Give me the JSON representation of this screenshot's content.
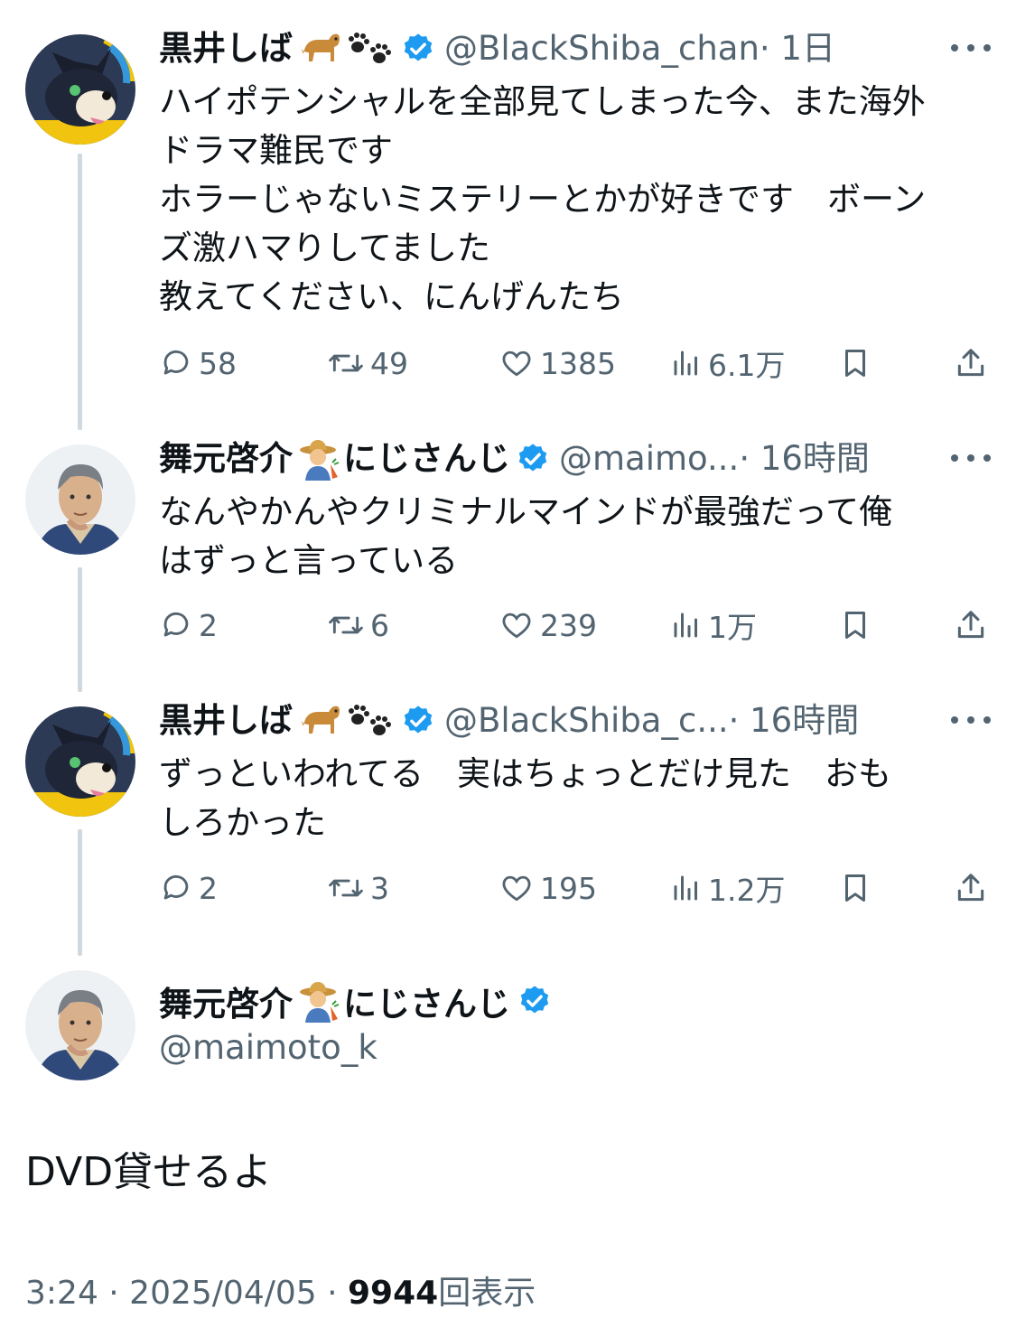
{
  "tweets": [
    {
      "name": "黒井しば",
      "handle": "@BlackShiba_chan",
      "time": "· 1日",
      "lines": [
        "ハイポテンシャルを全部見てしまった今、また海外",
        "ドラマ難民です",
        "ホラーじゃないミステリーとかが好きです　ボーン",
        "ズ激ハマりしてました",
        "教えてください、にんげんたち"
      ],
      "replies": "58",
      "retweets": "49",
      "likes": "1385",
      "views": "6.1万"
    },
    {
      "name": "舞元啓介",
      "name_suffix": "にじさんじ",
      "handle": "@maimo...",
      "time": "· 16時間",
      "lines": [
        "なんやかんやクリミナルマインドが最強だって俺",
        "はずっと言っている"
      ],
      "replies": "2",
      "retweets": "6",
      "likes": "239",
      "views": "1万"
    },
    {
      "name": "黒井しば",
      "handle": "@BlackShiba_c...",
      "time": "· 16時間",
      "lines": [
        "ずっといわれてる　実はちょっとだけ見た　おも",
        "しろかった"
      ],
      "replies": "2",
      "retweets": "3",
      "likes": "195",
      "views": "1.2万"
    }
  ],
  "main": {
    "name": "舞元啓介",
    "name_suffix": "にじさんじ",
    "handle": "@maimoto_k",
    "text": "DVD貸せるよ",
    "time": "3:24 · 2025/04/05 · ",
    "views_count": "9944",
    "views_label": "回表示"
  },
  "icons": {
    "reply": "reply-icon",
    "retweet": "retweet-icon",
    "like": "heart-icon",
    "views": "views-icon",
    "bookmark": "bookmark-icon",
    "share": "share-icon",
    "verified": "verified-badge-icon",
    "more": "more-icon"
  },
  "colors": {
    "verified": "#1d9bf0",
    "secondary": "#536471",
    "thread_line": "#cfd9de"
  }
}
